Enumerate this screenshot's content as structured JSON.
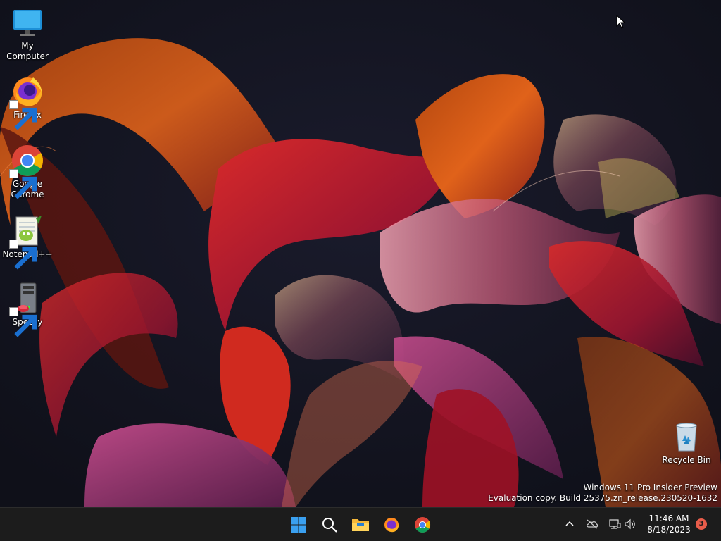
{
  "desktop": {
    "icons": [
      {
        "label": "My Computer",
        "icon": "monitor-icon"
      },
      {
        "label": "Firefox",
        "icon": "firefox-icon"
      },
      {
        "label": "Google Chrome",
        "icon": "chrome-icon"
      },
      {
        "label": "Notepad++",
        "icon": "notepadpp-icon"
      },
      {
        "label": "Speccy",
        "icon": "speccy-icon"
      },
      {
        "label": "Recycle Bin",
        "icon": "recycle-bin-icon"
      }
    ],
    "watermark": {
      "line1": "Windows 11 Pro Insider Preview",
      "line2": "Evaluation copy. Build 25375.zn_release.230520-1632"
    }
  },
  "taskbar": {
    "items": [
      {
        "name": "Start",
        "icon": "windows-start-icon"
      },
      {
        "name": "Search",
        "icon": "search-icon"
      },
      {
        "name": "File Explorer",
        "icon": "folder-icon"
      },
      {
        "name": "Firefox",
        "icon": "firefox-icon"
      },
      {
        "name": "Google Chrome",
        "icon": "chrome-icon"
      }
    ],
    "tray": {
      "time": "11:46 AM",
      "date": "8/18/2023",
      "notification_count": "3"
    }
  },
  "colors": {
    "taskbar_bg": "#1c1c1c",
    "badge": "#e85c4a",
    "start_blue": "#3aa0f0"
  }
}
